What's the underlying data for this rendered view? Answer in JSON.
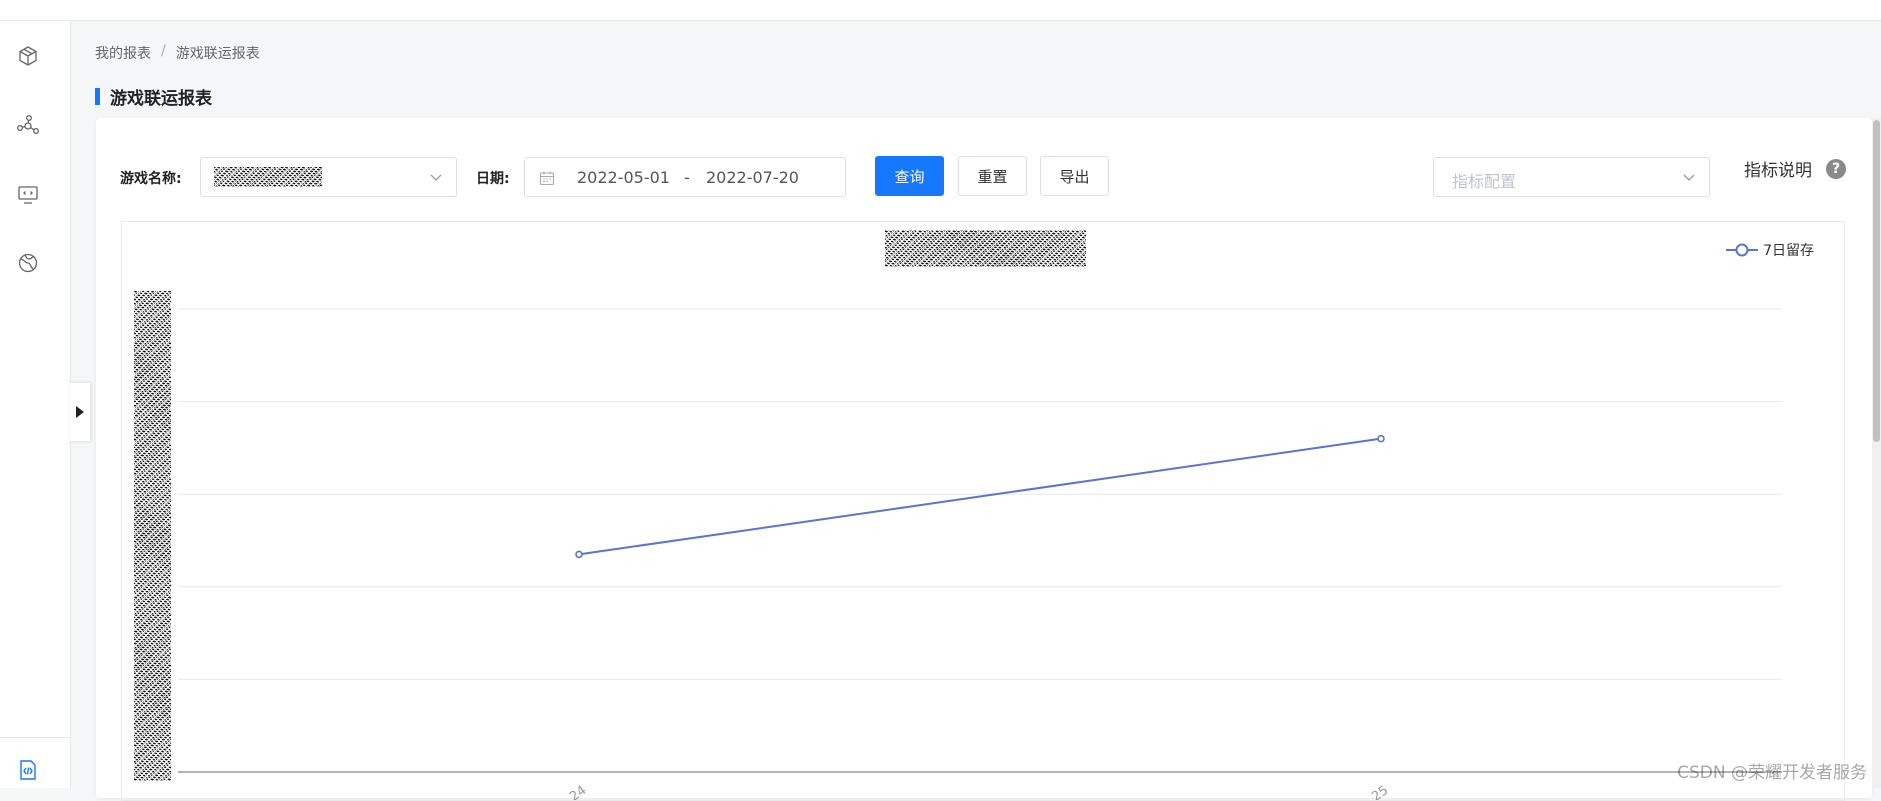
{
  "breadcrumb": {
    "root": "我的报表",
    "separator": "/",
    "current": "游戏联运报表"
  },
  "page_title": "游戏联运报表",
  "sidebar": {
    "icons": [
      "cube-icon",
      "share-nodes-icon",
      "monitor-code-icon",
      "globe-icon"
    ],
    "bottom_icon": "code-file-icon"
  },
  "filters": {
    "game_label": "游戏名称:",
    "date_label": "日期:",
    "date_start": "2022-05-01",
    "date_separator": "-",
    "date_end": "2022-07-20",
    "metric_placeholder": "指标配置"
  },
  "buttons": {
    "query": "查询",
    "reset": "重置",
    "export": "导出"
  },
  "help": {
    "label": "指标说明",
    "icon_glyph": "?"
  },
  "chart_data": {
    "type": "line",
    "title": "",
    "xlabel": "",
    "ylabel": "",
    "x": [
      "…24",
      "…25"
    ],
    "series": [
      {
        "name": "7日留存",
        "values": [
          2.35,
          3.6
        ]
      }
    ],
    "ylim": [
      0,
      5
    ],
    "grid": true,
    "legend_position": "top-right",
    "colors": {
      "series": "#5b73d1"
    }
  },
  "watermark": "CSDN @荣耀开发者服务",
  "colors": {
    "accent": "#1677ff",
    "series": "#5b73d1"
  }
}
